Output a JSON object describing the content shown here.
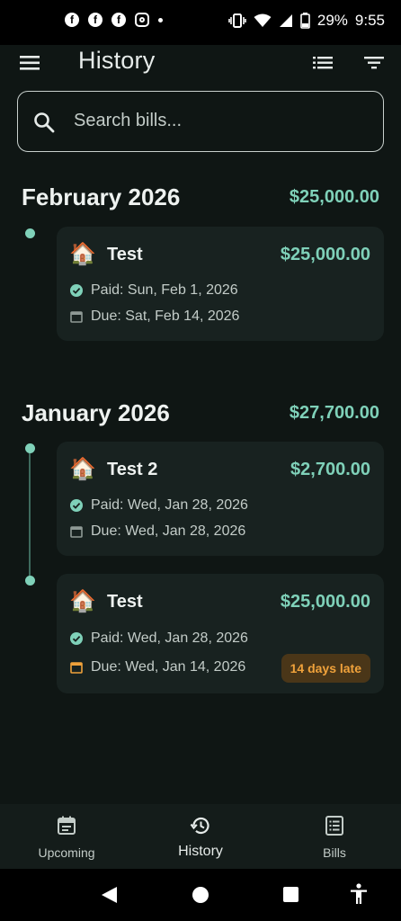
{
  "status_bar": {
    "notification_icons": [
      "facebook-icon",
      "facebook-icon",
      "facebook-icon",
      "instagram-icon",
      "more-notifications-dot"
    ],
    "battery": "29%",
    "time": "9:55"
  },
  "appbar": {
    "title": "History"
  },
  "search": {
    "placeholder": "Search bills...",
    "value": ""
  },
  "months": [
    {
      "title": "February 2026",
      "total": "$25,000.00",
      "bills": [
        {
          "emoji": "🏠",
          "name": "Test",
          "amount": "$25,000.00",
          "paid": "Paid: Sun, Feb 1, 2026",
          "due": "Due: Sat, Feb 14, 2026",
          "badge": ""
        }
      ]
    },
    {
      "title": "January 2026",
      "total": "$27,700.00",
      "bills": [
        {
          "emoji": "🏠",
          "name": "Test 2",
          "amount": "$2,700.00",
          "paid": "Paid: Wed, Jan 28, 2026",
          "due": "Due: Wed, Jan 28, 2026",
          "badge": ""
        },
        {
          "emoji": "🏠",
          "name": "Test",
          "amount": "$25,000.00",
          "paid": "Paid: Wed, Jan 28, 2026",
          "due": "Due: Wed, Jan 14, 2026",
          "badge": "14 days late"
        }
      ]
    }
  ],
  "bottom_nav": {
    "items": [
      {
        "label": "Upcoming",
        "icon": "calendar-icon",
        "active": false
      },
      {
        "label": "History",
        "icon": "history-icon",
        "active": true
      },
      {
        "label": "Bills",
        "icon": "receipt-icon",
        "active": false
      }
    ]
  },
  "colors": {
    "accent": "#7fd1b9",
    "late": "#f0a23b",
    "background": "#0f1614",
    "card": "#182220"
  }
}
